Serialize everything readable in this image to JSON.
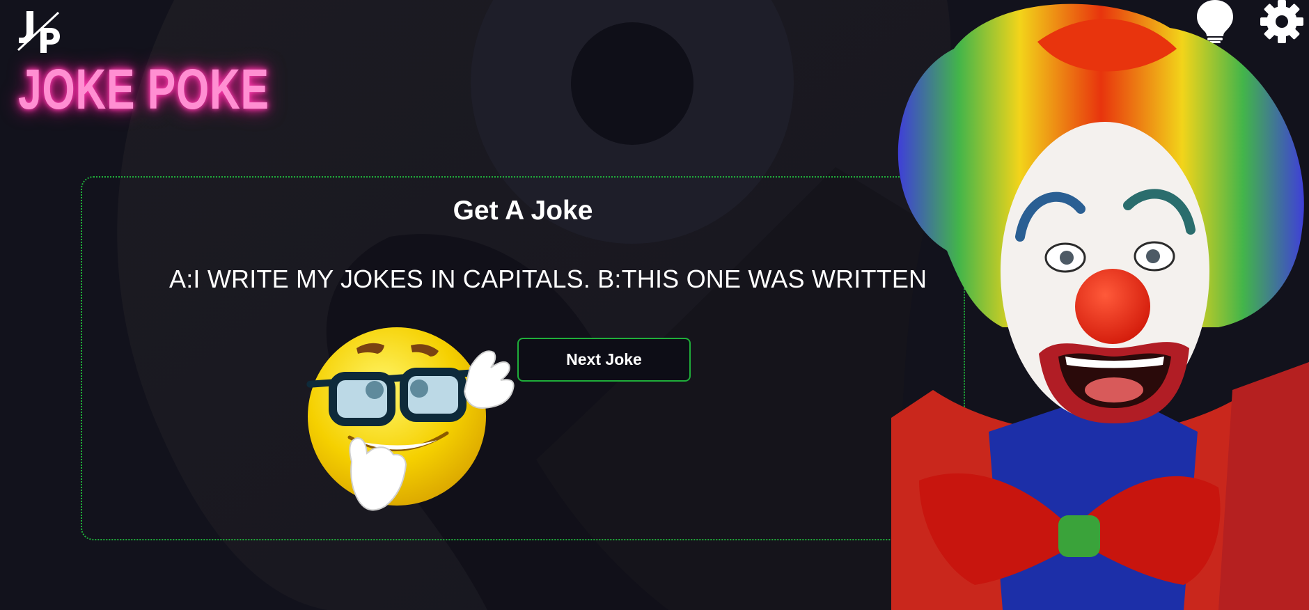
{
  "brand": {
    "logo_mark": "J/P logo",
    "title": "JOKE POKE",
    "title_color": "#ff8fd2"
  },
  "header": {
    "icons": [
      "lightbulb-icon",
      "gear-icon"
    ]
  },
  "card": {
    "title": "Get A Joke",
    "joke": "A:I WRITE MY JOKES IN CAPITALS. B:THIS ONE WAS WRITTEN",
    "next_button": "Next Joke",
    "accent": "#1fae3a"
  },
  "images": {
    "emoji": "nerd-emoji-with-glasses",
    "clown": "clown-with-rainbow-wig"
  }
}
